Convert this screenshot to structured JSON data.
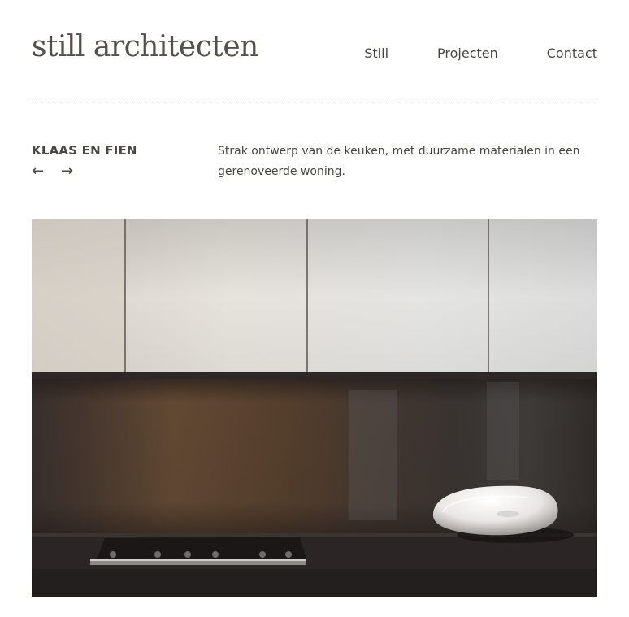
{
  "site": {
    "title": "still architecten"
  },
  "nav": {
    "items": [
      {
        "label": "Still"
      },
      {
        "label": "Projecten"
      },
      {
        "label": "Contact"
      }
    ]
  },
  "project": {
    "title": "KLAAS EN FIEN",
    "prev_arrow": "←",
    "next_arrow": "→",
    "description": "Strak ontwerp van de keuken, met duurzame materialen in een gerenoveerde woning."
  },
  "colors": {
    "text": "#4a4744",
    "title": "#55504c",
    "rule": "#9b9795"
  },
  "icons": {
    "prev": "arrow-left-icon",
    "next": "arrow-right-icon"
  }
}
